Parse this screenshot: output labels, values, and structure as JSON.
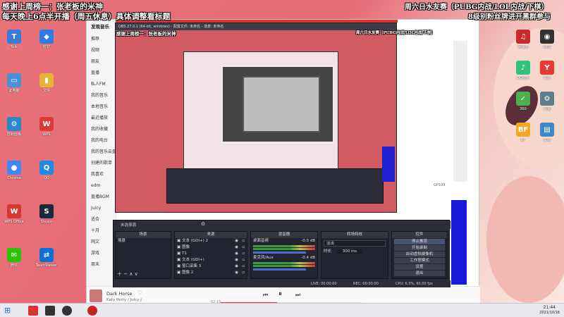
{
  "overlay": {
    "top_left_line1": "感谢上周榜一：张老板的米神",
    "top_left_line2": "每天晚上6点半开播（周五休息）具体调整看标题",
    "top_right_line1": "周六日水友赛（PUBG内战/LOL内战/下棋）",
    "top_right_line2": "8级别粉丝牌进开黑群参与"
  },
  "desktop_icons_left": [
    {
      "label": "Tolk",
      "color": "#3a7bd5",
      "glyph": "T"
    },
    {
      "label": "钉钉",
      "color": "#2e7ce4",
      "glyph": "◆"
    },
    {
      "label": "此电脑",
      "color": "#4a90d9",
      "glyph": "▭"
    },
    {
      "label": "文件",
      "color": "#e8b33a",
      "glyph": "▮"
    },
    {
      "label": "控制面板",
      "color": "#2f86c9",
      "glyph": "⚙"
    },
    {
      "label": "WPS",
      "color": "#d93a3a",
      "glyph": "W"
    },
    {
      "label": "Chrome",
      "color": "#4285f4",
      "glyph": "●"
    },
    {
      "label": "QQ",
      "color": "#1f8ae0",
      "glyph": "Q"
    },
    {
      "label": "WPS Office",
      "color": "#d6392f",
      "glyph": "W"
    },
    {
      "label": "Steam",
      "color": "#1b2838",
      "glyph": "S"
    },
    {
      "label": "微信",
      "color": "#2dc100",
      "glyph": "✉"
    },
    {
      "label": "TeamViewer",
      "color": "#0e6fd6",
      "glyph": "⇄"
    }
  ],
  "desktop_icons_right": [
    {
      "label": "网易云",
      "color": "#c92a2a",
      "glyph": "♫"
    },
    {
      "label": "OBS",
      "color": "#333",
      "glyph": "◉"
    },
    {
      "label": "QQ音乐",
      "color": "#31c27c",
      "glyph": "♪"
    },
    {
      "label": "有道",
      "color": "#e53935",
      "glyph": "Y"
    },
    {
      "label": "360",
      "color": "#4caf50",
      "glyph": "✓"
    },
    {
      "label": "设置",
      "color": "#607d8b",
      "glyph": "⚙"
    },
    {
      "label": "BF",
      "color": "#f5a623",
      "glyph": "BF"
    },
    {
      "label": "文档",
      "color": "#3f88c5",
      "glyph": "▤"
    }
  ],
  "music_app": {
    "brand": "发现音乐",
    "sidebar": [
      "推荐",
      "视频",
      "朋友",
      "直播",
      "私人FM",
      "我的音乐",
      "本地音乐",
      "最近播放",
      "我的收藏",
      "我的电台",
      "我的音乐云盘",
      "创建的歌单",
      "我喜欢",
      "edm",
      "直播BGM",
      "Juicy",
      "适合",
      "十月",
      "网文",
      "游戏",
      "周末"
    ],
    "track_title": "Dark Horse",
    "track_artist": "Katy Perry / Juicy J",
    "time": "02:15",
    "right_text": "GP100"
  },
  "obs": {
    "title": "OBS 27.0.1 (64-bit, windows) - 配置文件: 未命名 - 场景: 未命名",
    "menu": [
      "文件(F)",
      "编辑(E)",
      "视图(V)",
      "配置文件(P)",
      "场景集合(S)",
      "工具(T)",
      "帮助(H)"
    ],
    "scenes_header": "场景",
    "scenes": [
      "场景"
    ],
    "sources_header": "来源",
    "sources": [
      "文本 (GDI+) 2",
      "图像",
      "T1",
      "文本 (GDI+)",
      "窗口采集 3",
      "图像 2"
    ],
    "mixer_header": "混音器",
    "mixer": [
      {
        "name": "桌面音频",
        "db": "-0.0 dB"
      },
      {
        "name": "麦克风/Aux",
        "db": "-0.4 dB"
      }
    ],
    "transitions_header": "转场特效",
    "transition": "淡出",
    "duration_label": "时长",
    "duration": "300 ms",
    "controls_header": "控件",
    "controls": [
      "停止推流",
      "开始录制",
      "启动虚拟摄像机",
      "工作室模式",
      "设置",
      "退出"
    ],
    "status": {
      "live": "LIVE: 00:00:00",
      "rec": "REC: 00:00:00",
      "cpu": "CPU: 6.3%, 60.00 fps"
    },
    "scene_filter_label": "未选择源"
  },
  "taskbar": {
    "time": "21:44",
    "date": "2021/10/16"
  }
}
